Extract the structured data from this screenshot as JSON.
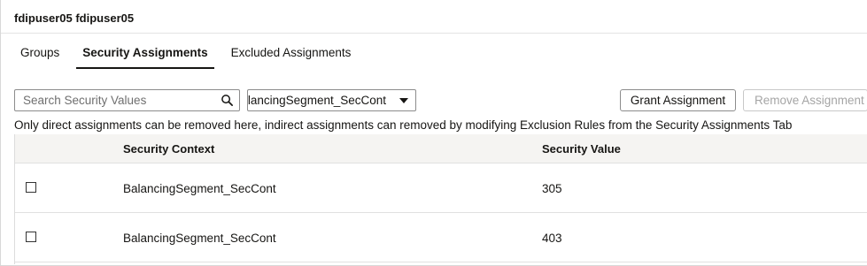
{
  "header": {
    "user_name": "fdipuser05 fdipuser05"
  },
  "tabs": [
    {
      "label": "Groups",
      "active": false
    },
    {
      "label": "Security Assignments",
      "active": true
    },
    {
      "label": "Excluded Assignments",
      "active": false
    }
  ],
  "toolbar": {
    "search_placeholder": "Search Security Values",
    "search_icon": "search-icon",
    "context_select_value": "ılancingSegment_SecCont",
    "grant_label": "Grant Assignment",
    "remove_label": "Remove Assignment"
  },
  "notice": "Only direct assignments can be removed here, indirect assignments can removed by modifying Exclusion Rules from the Security Assignments Tab",
  "table": {
    "columns": [
      "Security Context",
      "Security Value"
    ],
    "rows": [
      {
        "context": "BalancingSegment_SecCont",
        "value": "305",
        "checked": false
      },
      {
        "context": "BalancingSegment_SecCont",
        "value": "403",
        "checked": false
      }
    ]
  }
}
